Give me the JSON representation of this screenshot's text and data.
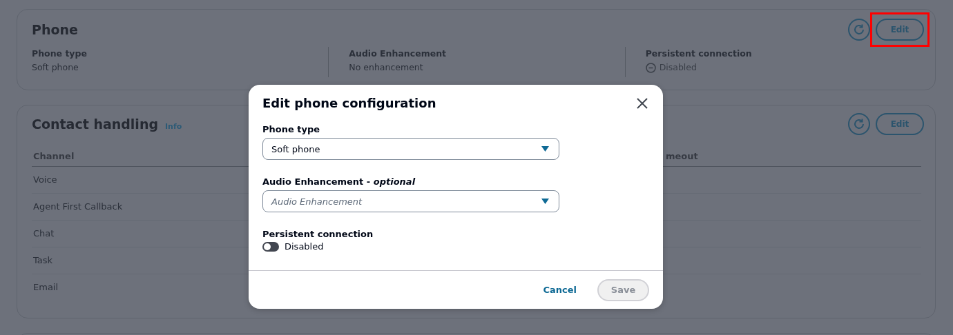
{
  "phone_card": {
    "title": "Phone",
    "edit_button": {
      "label": "Edit",
      "highlighted": true
    },
    "fields": [
      {
        "label": "Phone type",
        "value": "Soft phone",
        "kind": "text"
      },
      {
        "label": "Audio Enhancement",
        "value": "No enhancement",
        "kind": "text"
      },
      {
        "label": "Persistent connection",
        "value": "Disabled",
        "kind": "status"
      }
    ]
  },
  "contact_card": {
    "title": "Contact handling",
    "info_link": "Info",
    "edit_button": {
      "label": "Edit",
      "highlighted": false
    },
    "table": {
      "columns": [
        "Channel",
        "meout"
      ],
      "rows": [
        "Voice",
        "Agent First Callback",
        "Chat",
        "Task",
        "Email"
      ]
    }
  },
  "dialog": {
    "title": "Edit phone configuration",
    "phone_type": {
      "label": "Phone type",
      "value": "Soft phone"
    },
    "audio": {
      "label": "Audio Enhancement - *optional*",
      "placeholder": "Audio Enhancement"
    },
    "persistent": {
      "label": "Persistent connection",
      "on": false,
      "text": "Disabled"
    },
    "cancel": "Cancel",
    "save": {
      "label": "Save",
      "disabled": true
    }
  }
}
